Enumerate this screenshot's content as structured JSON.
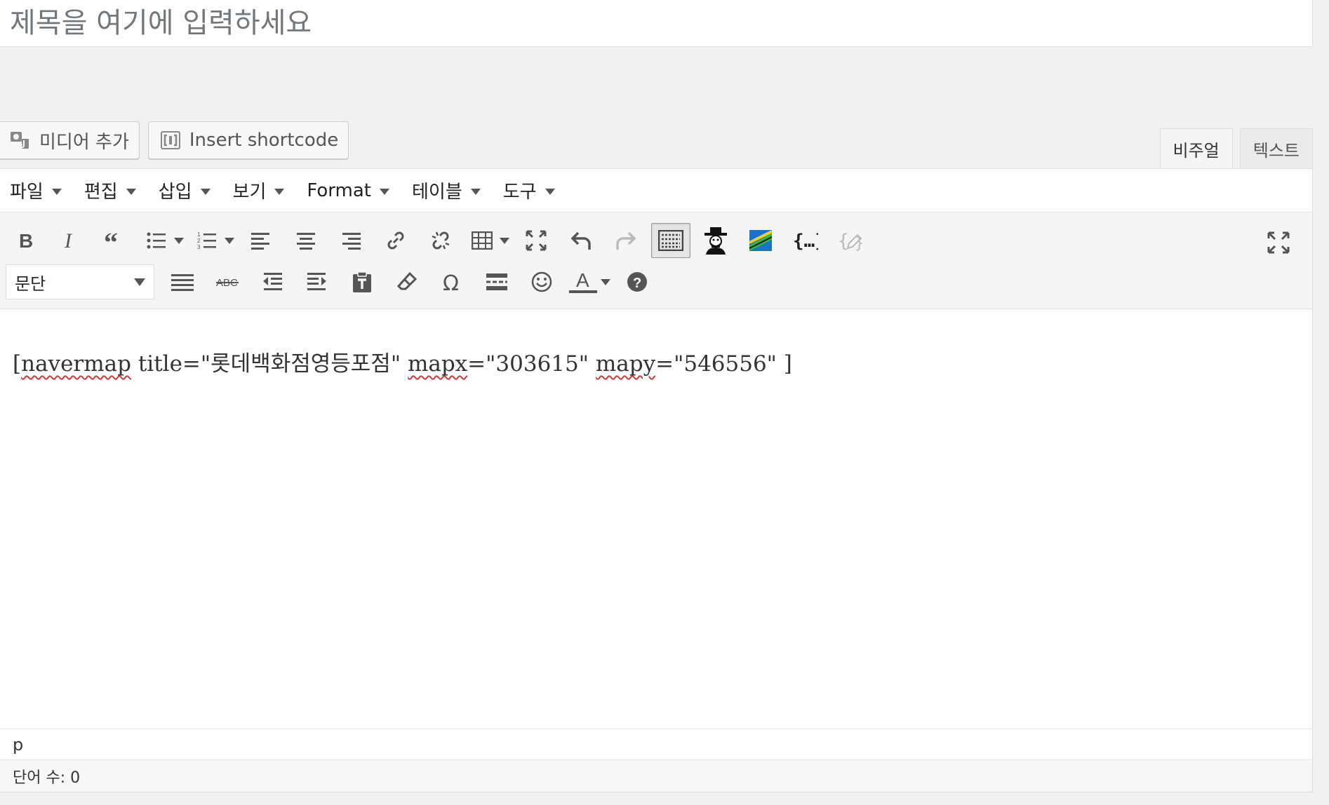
{
  "title_input": {
    "placeholder": "제목을 여기에 입력하세요",
    "value": ""
  },
  "media_buttons": {
    "add_media": {
      "label": "미디어 추가",
      "icon": "media-icon"
    },
    "insert_shortcode": {
      "label": "Insert shortcode",
      "icon": "shortcode-icon"
    }
  },
  "mode_tabs": {
    "visual": "비주얼",
    "text": "텍스트",
    "active": "visual"
  },
  "menubar": [
    {
      "label": "파일"
    },
    {
      "label": "편집"
    },
    {
      "label": "삽입"
    },
    {
      "label": "보기"
    },
    {
      "label": "Format"
    },
    {
      "label": "테이블"
    },
    {
      "label": "도구"
    }
  ],
  "toolbar_row1": [
    "bold-icon",
    "italic-icon",
    "blockquote-icon",
    "bullet-list-icon",
    "numbered-list-icon",
    "align-left-icon",
    "align-center-icon",
    "align-right-icon",
    "link-icon",
    "unlink-icon",
    "table-icon",
    "fullscreen-icon",
    "undo-icon",
    "redo-icon",
    "toolbar-toggle-icon",
    "navermap-plugin-icon",
    "map-plugin-icon",
    "code-brackets-icon",
    "edit-pencil-icon"
  ],
  "toolbar_row2": {
    "format_select": "문단",
    "icons": [
      "justify-icon",
      "strikethrough-icon",
      "outdent-icon",
      "indent-icon",
      "paste-text-icon",
      "clear-format-icon",
      "omega-icon",
      "read-more-icon",
      "emoticon-icon",
      "text-color-icon",
      "help-icon"
    ]
  },
  "content": {
    "p1": "[",
    "s1": "navermap",
    "p2": " title=\"롯데백화점영등포점\" ",
    "s2": "mapx",
    "p3": "=\"303615\" ",
    "s3": "mapy",
    "p4": "=\"546556\" ]"
  },
  "status": {
    "path": "p",
    "word_count": "단어 수: 0"
  }
}
